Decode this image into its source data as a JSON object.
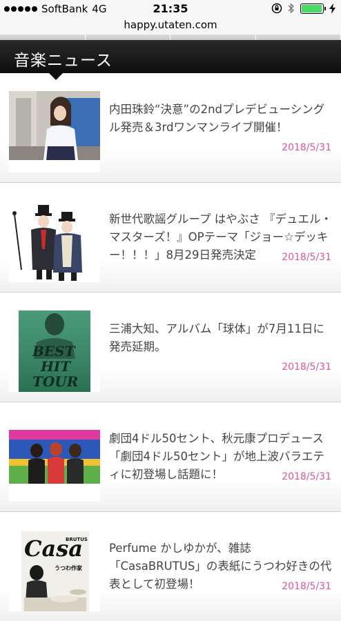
{
  "status": {
    "carrier": "SoftBank",
    "network": "4G",
    "time": "21:35",
    "battery_level": 0.95
  },
  "browser": {
    "url": "happy.utaten.com"
  },
  "section": {
    "title": "音楽ニュース"
  },
  "news": [
    {
      "headline": "内田珠鈴“決意”の2ndプレデビューシングル発売＆3rdワンマンライブ開催！",
      "date": "2018/5/31"
    },
    {
      "headline": "新世代歌謡グループ はやぶさ 『デュエル・マスターズ！』OPテーマ「ジョー☆デッキー！！！」8月29日発売決定",
      "date": "2018/5/31"
    },
    {
      "headline": "三浦大知、アルバム「球体」が7月11日に発売延期。",
      "date": "2018/5/31"
    },
    {
      "headline": "劇団4ドル50セント、秋元康プロデュース「劇団4ドル50セント」が地上波バラエティに初登場し話題に！",
      "date": "2018/5/31"
    },
    {
      "headline": "Perfume かしゆかが、雑誌「CasaBRUTUS」の表紙にうつわ好きの代表として初登場！",
      "date": "2018/5/31"
    }
  ],
  "thumb_text": {
    "tour_line1": "BEST",
    "tour_line2": "HIT",
    "tour_line3": "TOUR",
    "magazine_title": "Casa",
    "magazine_sub": "BRUTUS",
    "magazine_cover_text": "うつわ作家"
  }
}
